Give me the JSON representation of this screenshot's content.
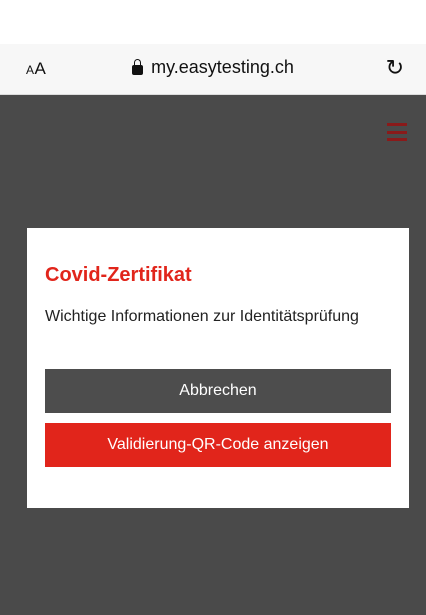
{
  "browser": {
    "aa_small": "A",
    "aa_large": "A",
    "url": "my.easytesting.ch",
    "reload_glyph": "↻",
    "icons": [
      "lock-icon",
      "reload-icon",
      "menu-icon"
    ]
  },
  "colors": {
    "accent": "#e1251b",
    "overlay": "#4a4a4a",
    "cancel_button": "#4d4d4d",
    "menu_icon": "#8a1a1a"
  },
  "modal": {
    "title": "Covid-Zertifikat",
    "message": "Wichtige Informationen zur Identitätsprüfung",
    "cancel_label": "Abbrechen",
    "confirm_label": "Validierung-QR-Code anzeigen"
  }
}
